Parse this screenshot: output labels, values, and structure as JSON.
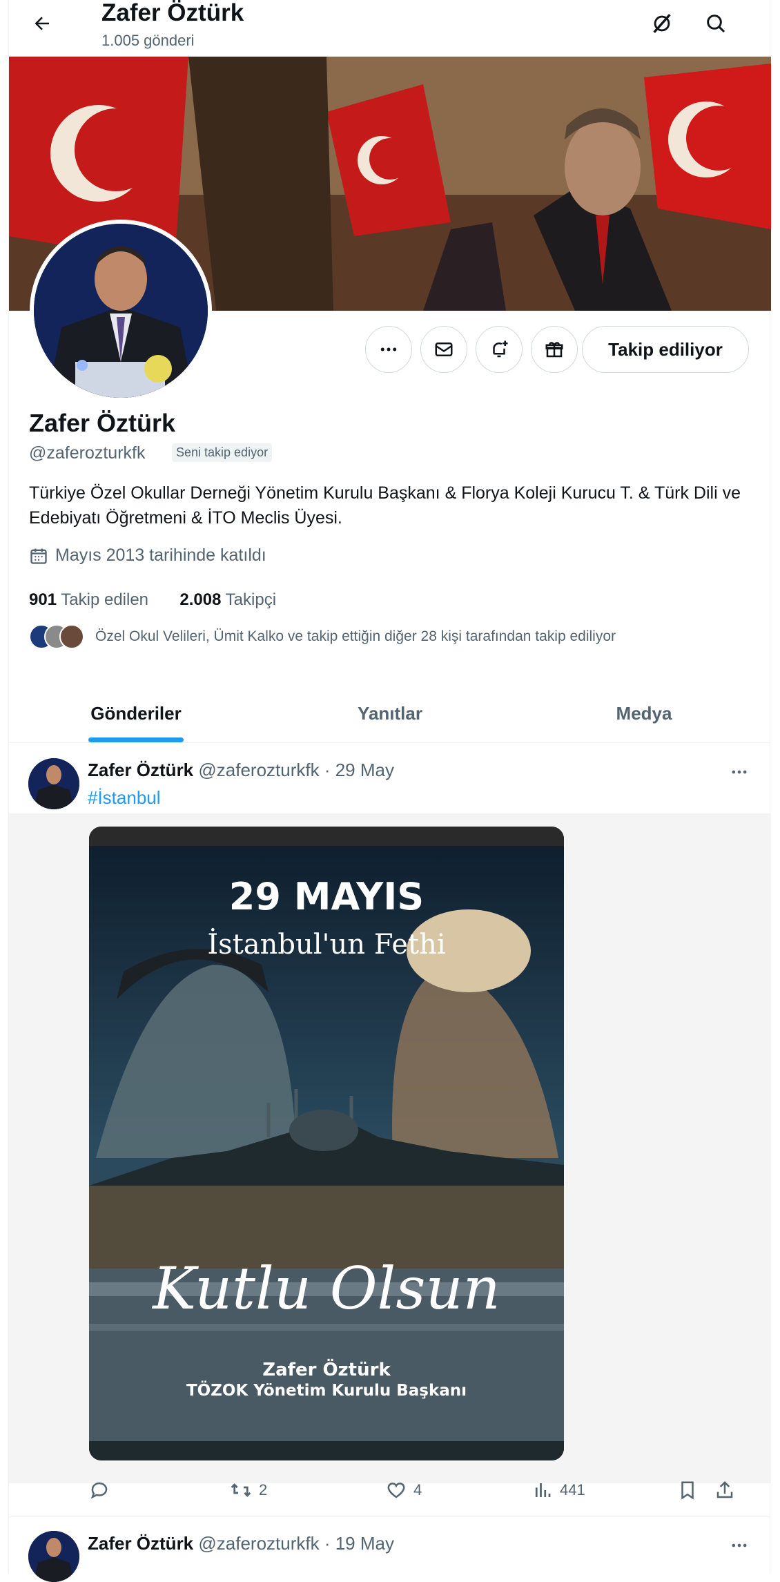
{
  "header": {
    "title": "Zafer Öztürk",
    "post_count": "1.005 gönderi"
  },
  "profile": {
    "name": "Zafer Öztürk",
    "handle": "@zaferozturkfk",
    "follows_you": "Seni takip ediyor",
    "bio": "Türkiye Özel Okullar Derneği Yönetim Kurulu Başkanı & Florya Koleji Kurucu T. & Türk Dili ve Edebiyatı Öğretmeni & İTO Meclis Üyesi.",
    "joined": "Mayıs 2013 tarihinde katıldı",
    "following_count": "901",
    "following_label": "Takip edilen",
    "followers_count": "2.008",
    "followers_label": "Takipçi",
    "followed_by": "Özel Okul Velileri, Ümit Kalko ve takip ettiğin diğer 28 kişi tarafından takip ediliyor",
    "follow_button": "Takip ediliyor"
  },
  "tabs": [
    {
      "label": "Gönderiler"
    },
    {
      "label": "Yanıtlar"
    },
    {
      "label": "Medya"
    }
  ],
  "tweets": [
    {
      "name": "Zafer Öztürk",
      "meta": "@zaferozturkfk · 29 May",
      "hashtag": "#İstanbul",
      "image_text": {
        "line1": "29 MAYIS",
        "line2": "İstanbul'un Fethi",
        "line3": "Kutlu Olsun",
        "line4": "Zafer Öztürk",
        "line5": "TÖZOK Yönetim Kurulu Başkanı"
      },
      "retweets": "2",
      "likes": "4",
      "views": "441"
    },
    {
      "name": "Zafer Öztürk",
      "meta": "@zaferozturkfk · 19 May"
    }
  ],
  "colors": {
    "accent": "#1d9bf0",
    "secondary_text": "#536471",
    "border": "#cfd9de"
  }
}
